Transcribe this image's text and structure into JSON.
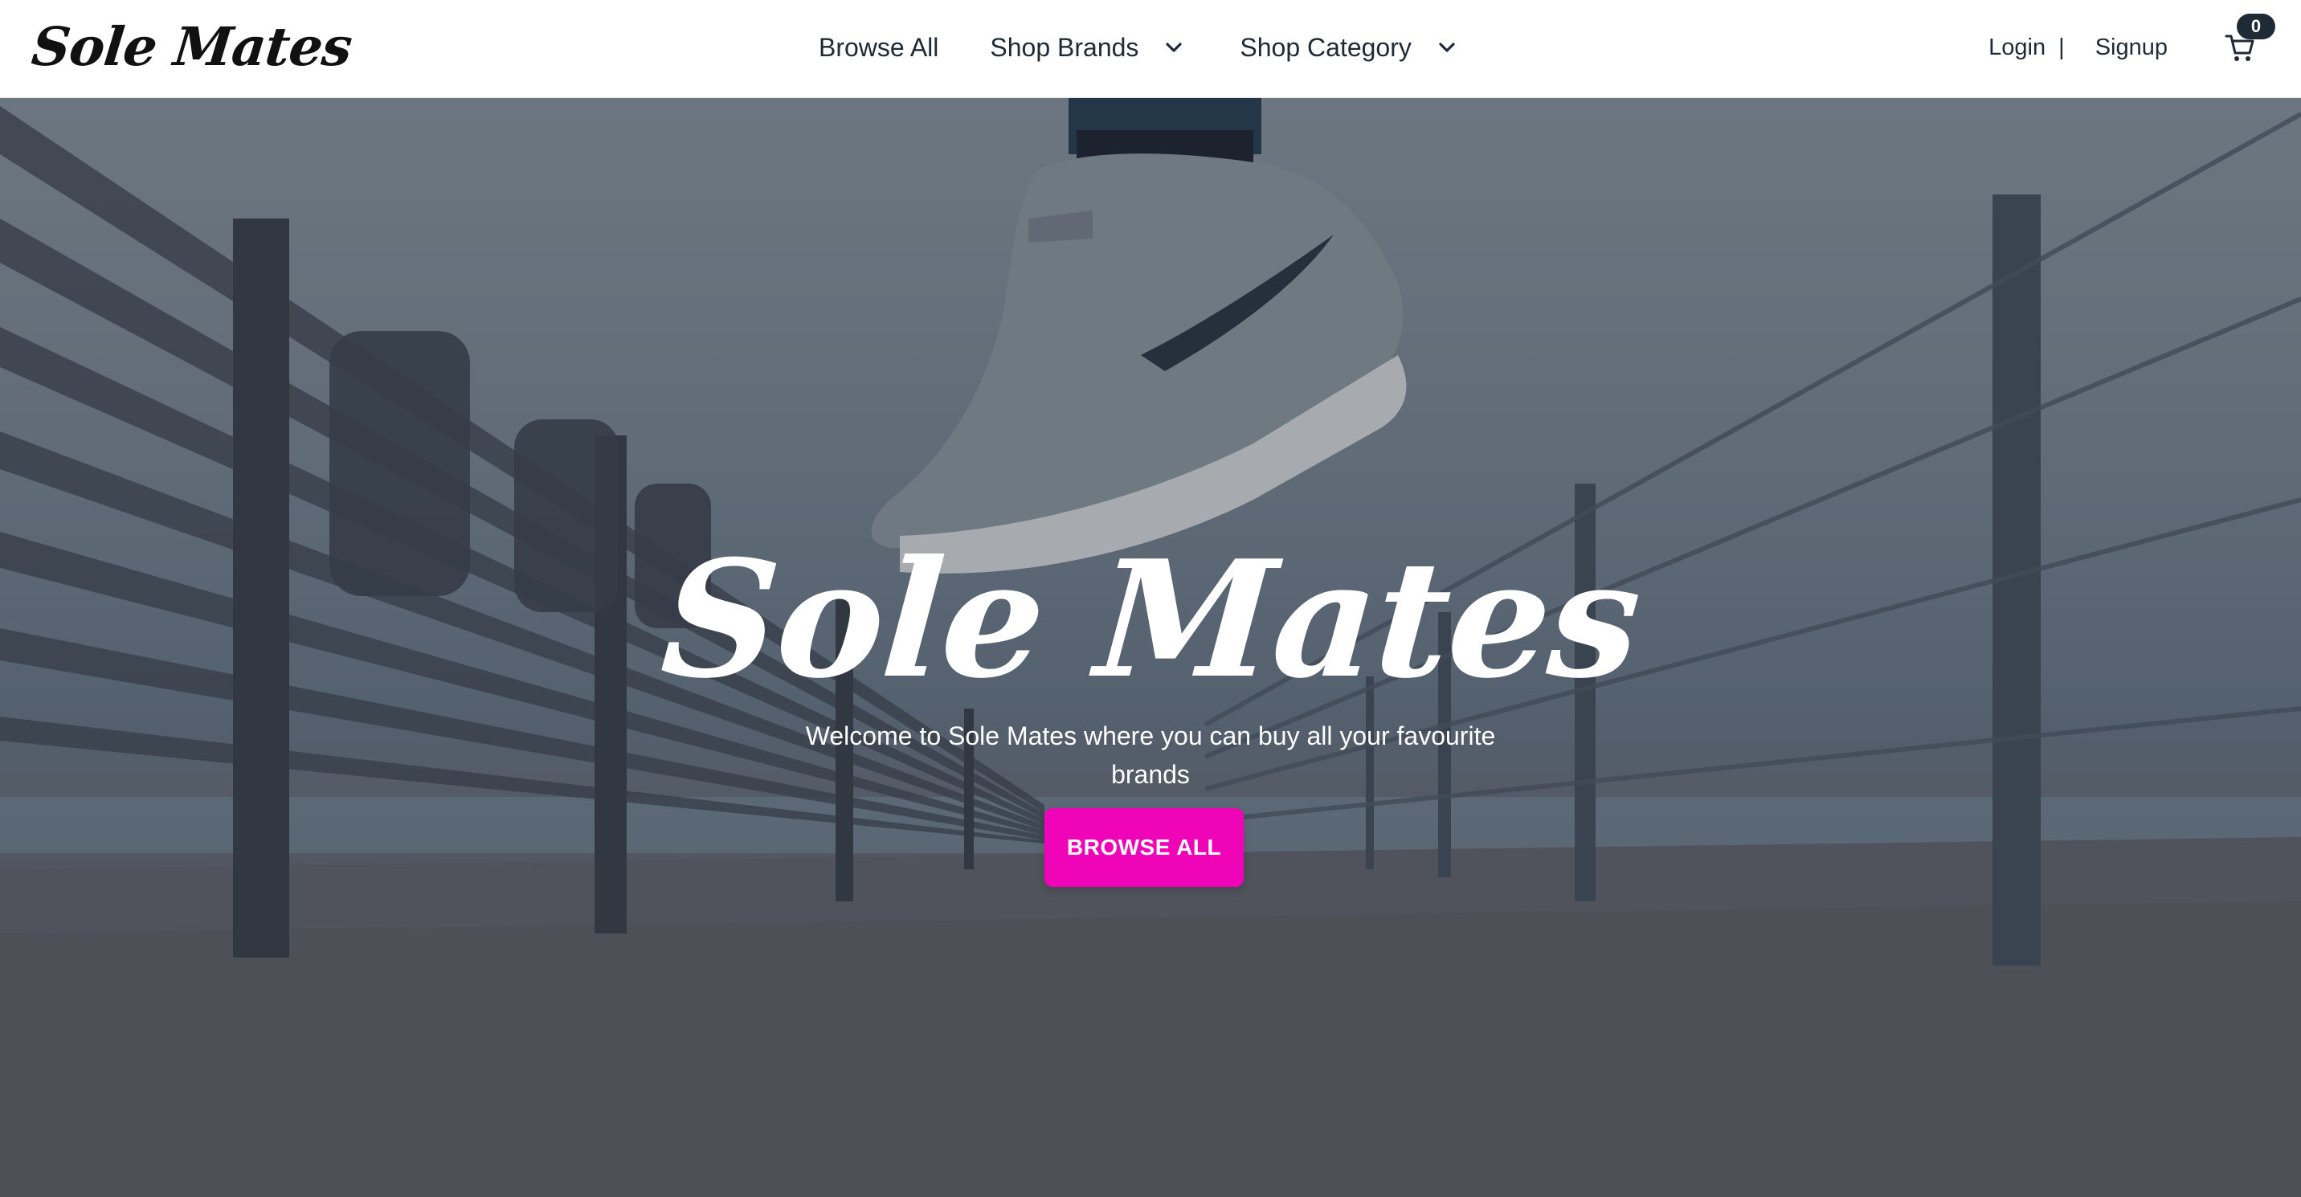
{
  "brand": {
    "logo_text": "Sole Mates"
  },
  "nav": {
    "browse_all": "Browse All",
    "shop_brands": "Shop Brands",
    "shop_category": "Shop Category",
    "chevron_icon": "chevron-down-icon"
  },
  "auth": {
    "login": "Login",
    "separator": "|",
    "signup": "Signup"
  },
  "cart": {
    "icon": "cart-icon",
    "count": "0"
  },
  "hero": {
    "title": "Sole Mates",
    "subtitle": "Welcome to Sole Mates where you can buy all your favourite brands",
    "cta_label": "BROWSE ALL",
    "background": "sneaker-on-pier-photo"
  },
  "colors": {
    "accent": "#f004b8",
    "nav_text": "#1f2a37",
    "badge_bg": "#1f2a37",
    "hero_text": "#ffffff"
  }
}
